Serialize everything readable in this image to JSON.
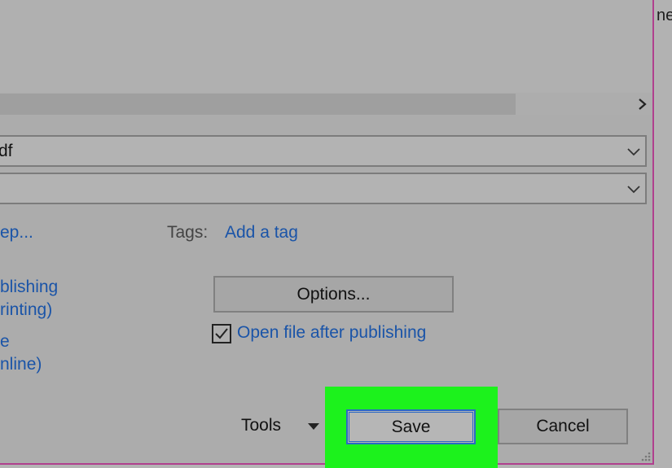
{
  "window": {
    "background_text": "ne"
  },
  "file_name": {
    "value": "df"
  },
  "save_as_type": {
    "value": ""
  },
  "metadata": {
    "authors_link_partial": "ep...",
    "tags_label": "Tags:",
    "tags_link": "Add a tag"
  },
  "optimize": {
    "standard_line1": "blishing",
    "standard_line2": "rinting)",
    "minimum_line1": "e",
    "minimum_line2": "nline)"
  },
  "options_button": {
    "label": "Options..."
  },
  "open_after_publishing": {
    "label": "Open file after publishing",
    "checked": true
  },
  "footer": {
    "tools_label": "Tools",
    "save_label": "Save",
    "cancel_label": "Cancel"
  },
  "colors": {
    "highlight": "#1cf21c",
    "link": "#1a54a8",
    "focus_border": "#2a69c4",
    "window_border": "#b0408e"
  }
}
